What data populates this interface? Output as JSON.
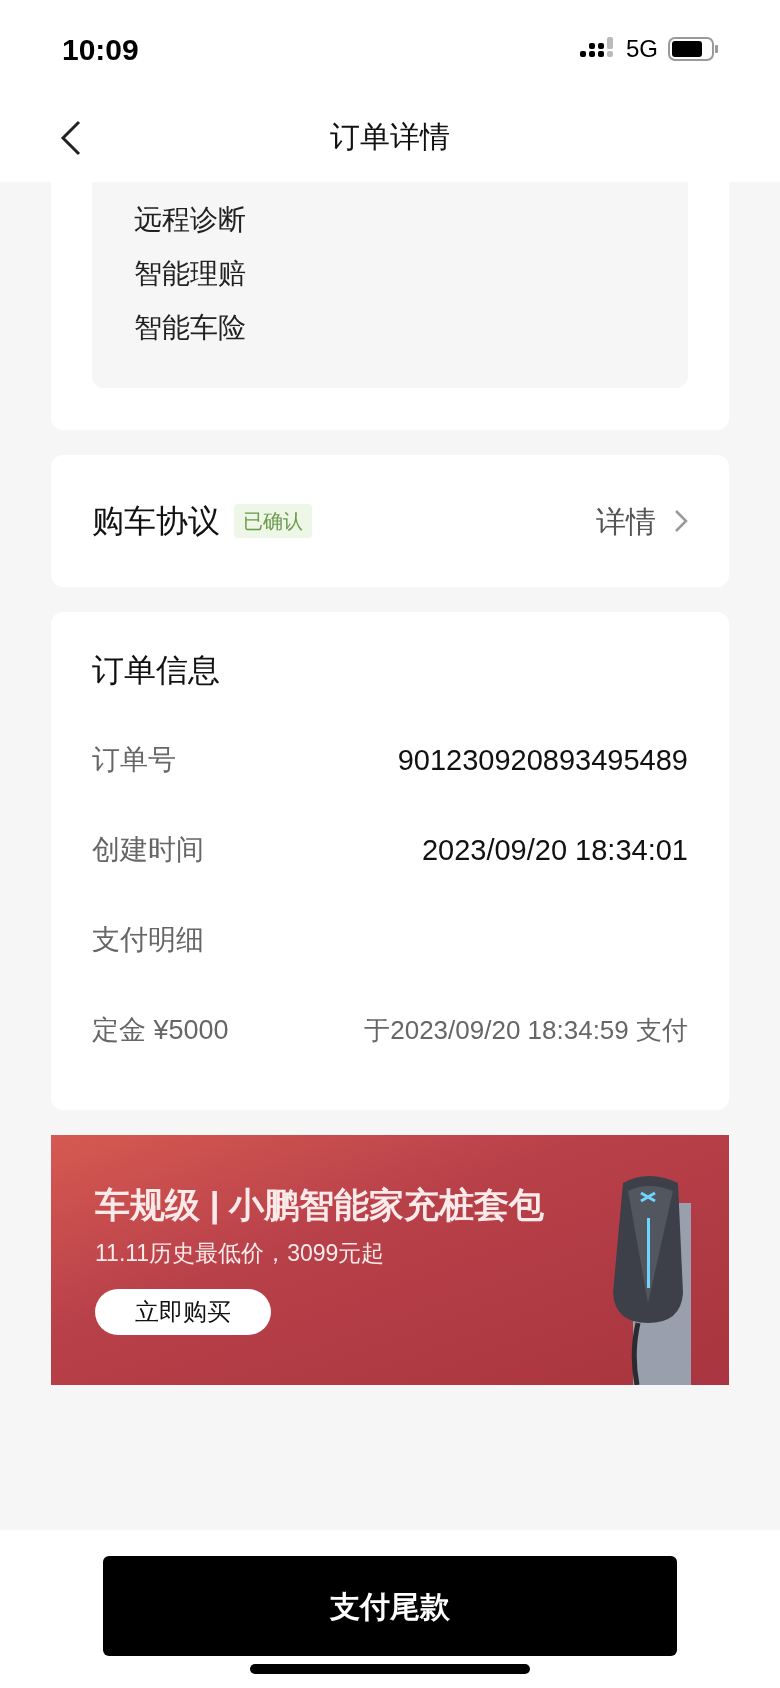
{
  "status_bar": {
    "time": "10:09",
    "network": "5G"
  },
  "nav": {
    "title": "订单详情"
  },
  "services": [
    "远程诊断",
    "智能理赔",
    "智能车险"
  ],
  "agreement": {
    "title": "购车协议",
    "badge": "已确认",
    "link": "详情"
  },
  "order_info": {
    "title": "订单信息",
    "rows": [
      {
        "label": "订单号",
        "value": "901230920893495489"
      },
      {
        "label": "创建时间",
        "value": "2023/09/20 18:34:01"
      }
    ],
    "payment": {
      "title": "支付明细",
      "items": [
        {
          "label": "定金 ¥5000",
          "value": "于2023/09/20 18:34:59 支付"
        }
      ]
    }
  },
  "banner": {
    "title": "车规级 | 小鹏智能家充桩套包",
    "subtitle": "11.11历史最低价，3099元起",
    "button": "立即购买"
  },
  "pay_button": "支付尾款"
}
